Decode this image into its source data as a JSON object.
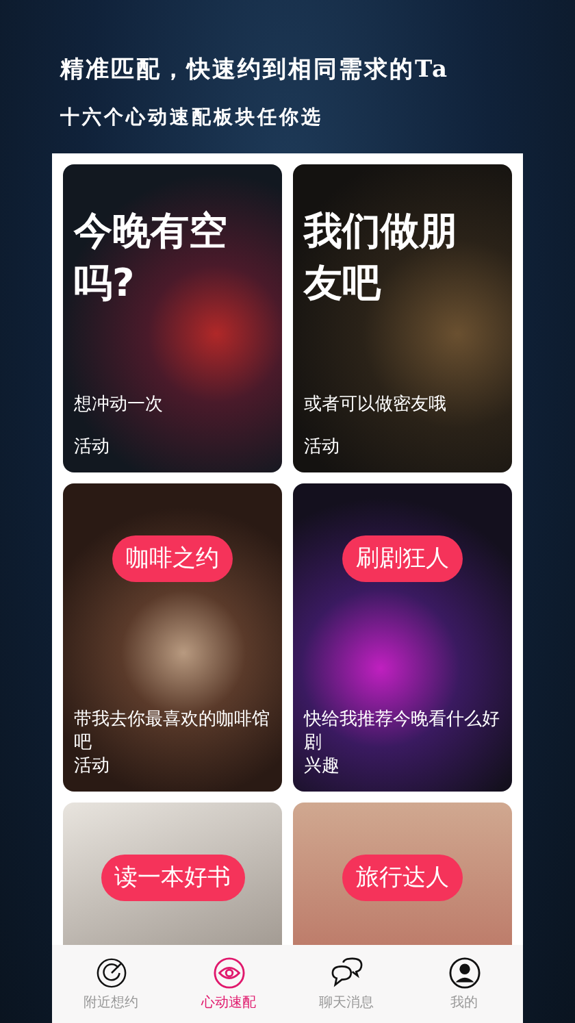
{
  "header": {
    "headline": "精准匹配，快速约到相同需求的Ta",
    "subline": "十六个心动速配板块任你选"
  },
  "cards": [
    {
      "kind": "big",
      "title": "今晚有空吗?",
      "subtitle": "想冲动一次",
      "tag": "活动"
    },
    {
      "kind": "big",
      "title": "我们做朋友吧",
      "subtitle": "或者可以做密友哦",
      "tag": "活动"
    },
    {
      "kind": "pill",
      "title": "咖啡之约",
      "subtitle": "带我去你最喜欢的咖啡馆吧",
      "tag": "活动"
    },
    {
      "kind": "pill",
      "title": "刷剧狂人",
      "subtitle": "快给我推荐今晚看什么好剧",
      "tag": "兴趣"
    },
    {
      "kind": "pill",
      "title": "读一本好书"
    },
    {
      "kind": "pill",
      "title": "旅行达人"
    }
  ],
  "tabs": [
    {
      "label": "附近想约",
      "selected": false
    },
    {
      "label": "心动速配",
      "selected": true
    },
    {
      "label": "聊天消息",
      "selected": false
    },
    {
      "label": "我的",
      "selected": false
    }
  ]
}
